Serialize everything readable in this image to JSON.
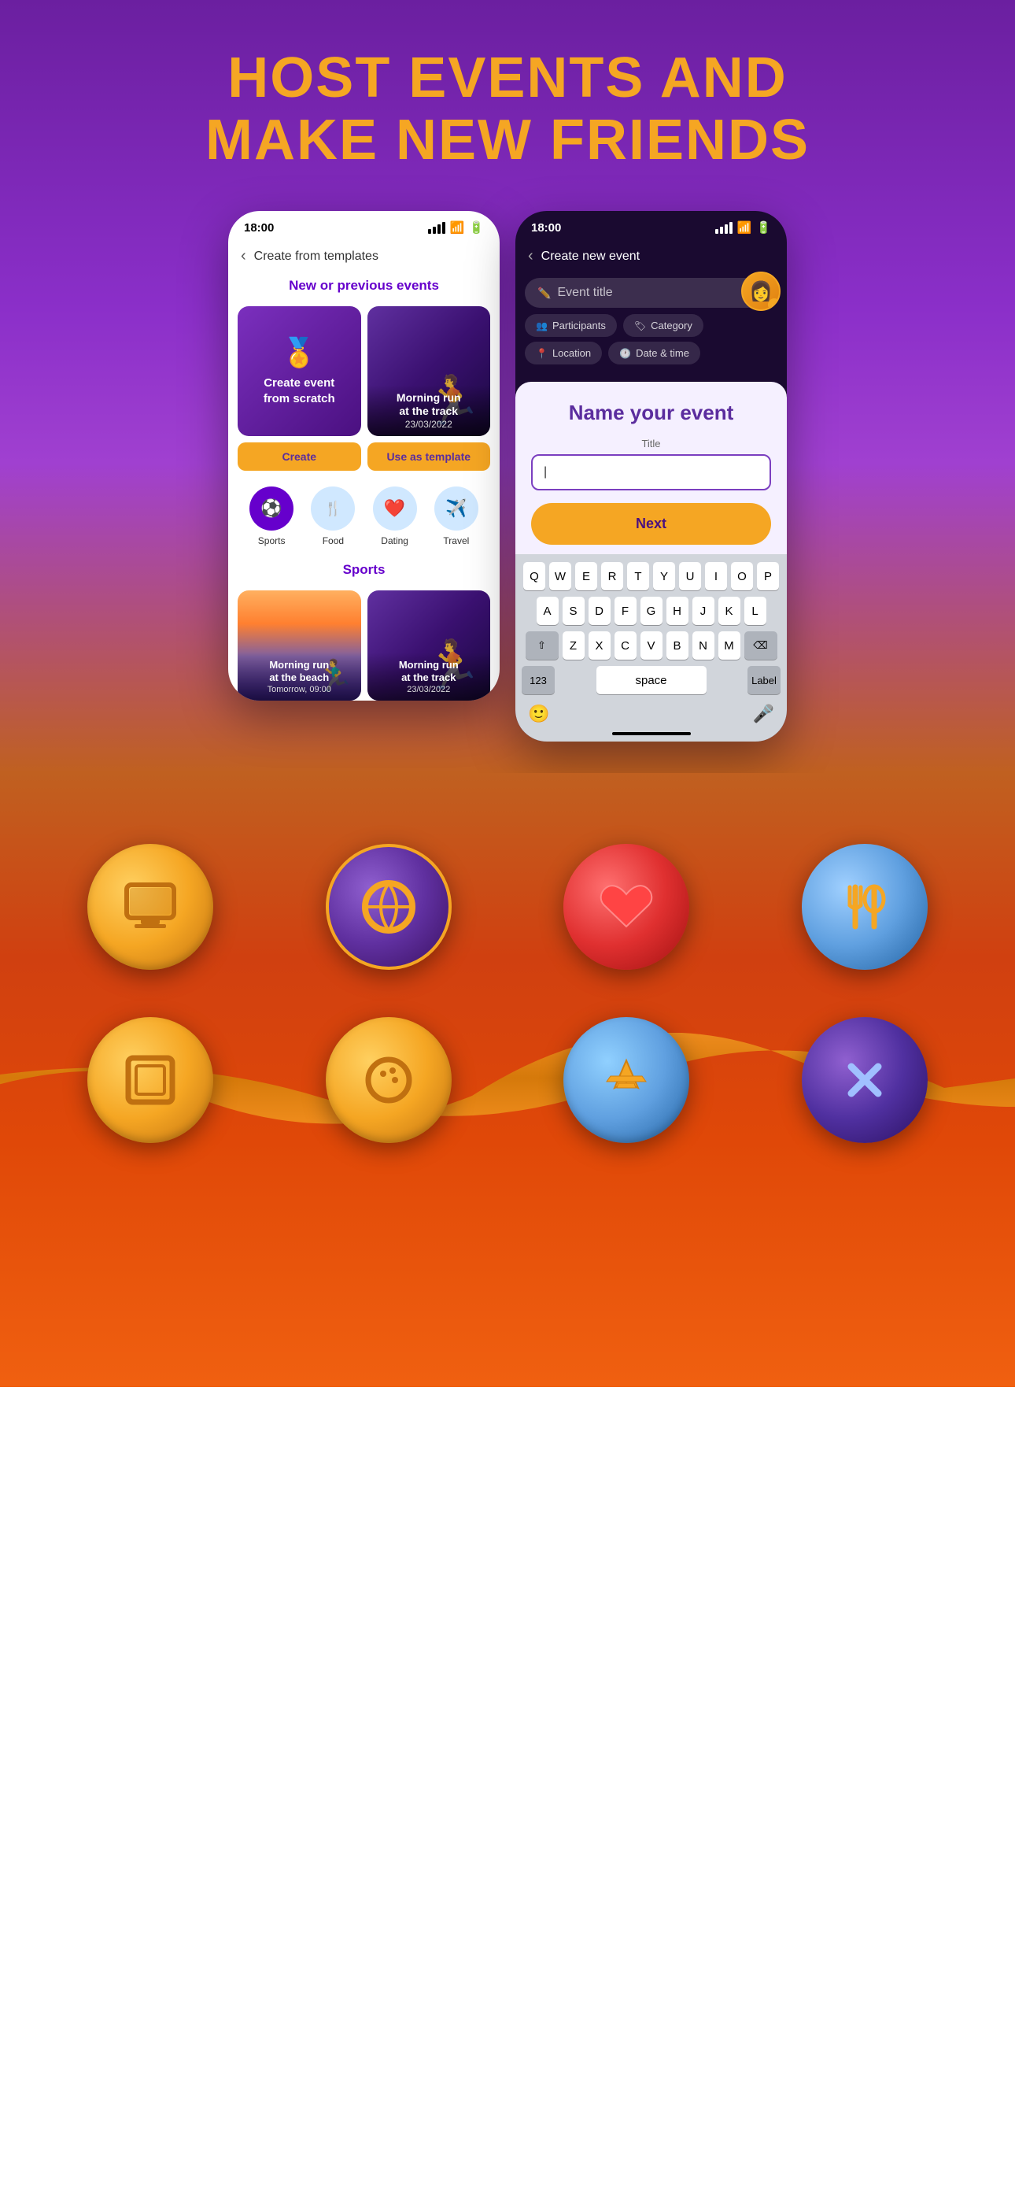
{
  "hero": {
    "title_line1": "HOST EVENTS AND",
    "title_line2": "MAKE NEW FRIENDS"
  },
  "left_phone": {
    "status_time": "18:00",
    "nav_back": "Create from templates",
    "section_new": "New or previous events",
    "card_create": {
      "icon": "🏅",
      "text_line1": "Create event",
      "text_line2": "from scratch"
    },
    "card_morning_track": {
      "title_line1": "Morning run",
      "title_line2": "at the track",
      "date": "23/03/2022"
    },
    "btn_create": "Create",
    "btn_template": "Use as template",
    "categories": [
      {
        "label": "Sports",
        "icon": "⚽",
        "active": true
      },
      {
        "label": "Food",
        "icon": "🍴",
        "active": false
      },
      {
        "label": "Dating",
        "icon": "❤️",
        "active": false
      },
      {
        "label": "Travel",
        "icon": "✈️",
        "active": false
      }
    ],
    "section_sports": "Sports",
    "sports_cards": [
      {
        "title_line1": "Morning run",
        "title_line2": "at the beach",
        "date": "Tomorrow, 09:00"
      },
      {
        "title_line1": "Morning run",
        "title_line2": "at the track",
        "date": "23/03/2022"
      }
    ]
  },
  "right_phone": {
    "status_time": "18:00",
    "nav_back": "Create new event",
    "form": {
      "event_title_placeholder": "Event title",
      "chips": [
        "Participants",
        "Category",
        "Location",
        "Date & time"
      ],
      "panel_heading": "Name your event",
      "input_label": "Title",
      "input_value": "|",
      "next_btn": "Next"
    },
    "keyboard": {
      "row1": [
        "Q",
        "W",
        "E",
        "R",
        "T",
        "Y",
        "U",
        "I",
        "O",
        "P"
      ],
      "row2": [
        "A",
        "S",
        "D",
        "F",
        "G",
        "H",
        "J",
        "K",
        "L"
      ],
      "row3": [
        "Z",
        "X",
        "C",
        "V",
        "B",
        "N",
        "M"
      ],
      "btn_numbers": "123",
      "btn_space": "space",
      "btn_label": "Label"
    }
  },
  "bottom_icons": [
    {
      "type": "yellow",
      "icon": "🖥",
      "row": 1
    },
    {
      "type": "purple-border",
      "icon": "⚽",
      "row": 1
    },
    {
      "type": "red",
      "icon": "❤️",
      "row": 1
    },
    {
      "type": "blue",
      "icon": "🍴",
      "row": 1
    },
    {
      "type": "yellow",
      "icon": "🖼",
      "row": 2
    },
    {
      "type": "yellow",
      "icon": "🎳",
      "row": 2
    },
    {
      "type": "yellow",
      "icon": "✈️",
      "row": 2
    },
    {
      "type": "purple",
      "icon": "✕",
      "row": 2
    }
  ],
  "colors": {
    "purple_dark": "#4A1080",
    "purple_mid": "#6600CC",
    "yellow": "#F5A623",
    "orange": "#E04808",
    "bg_top": "#7B2FBE",
    "bg_bottom": "#C06020"
  }
}
